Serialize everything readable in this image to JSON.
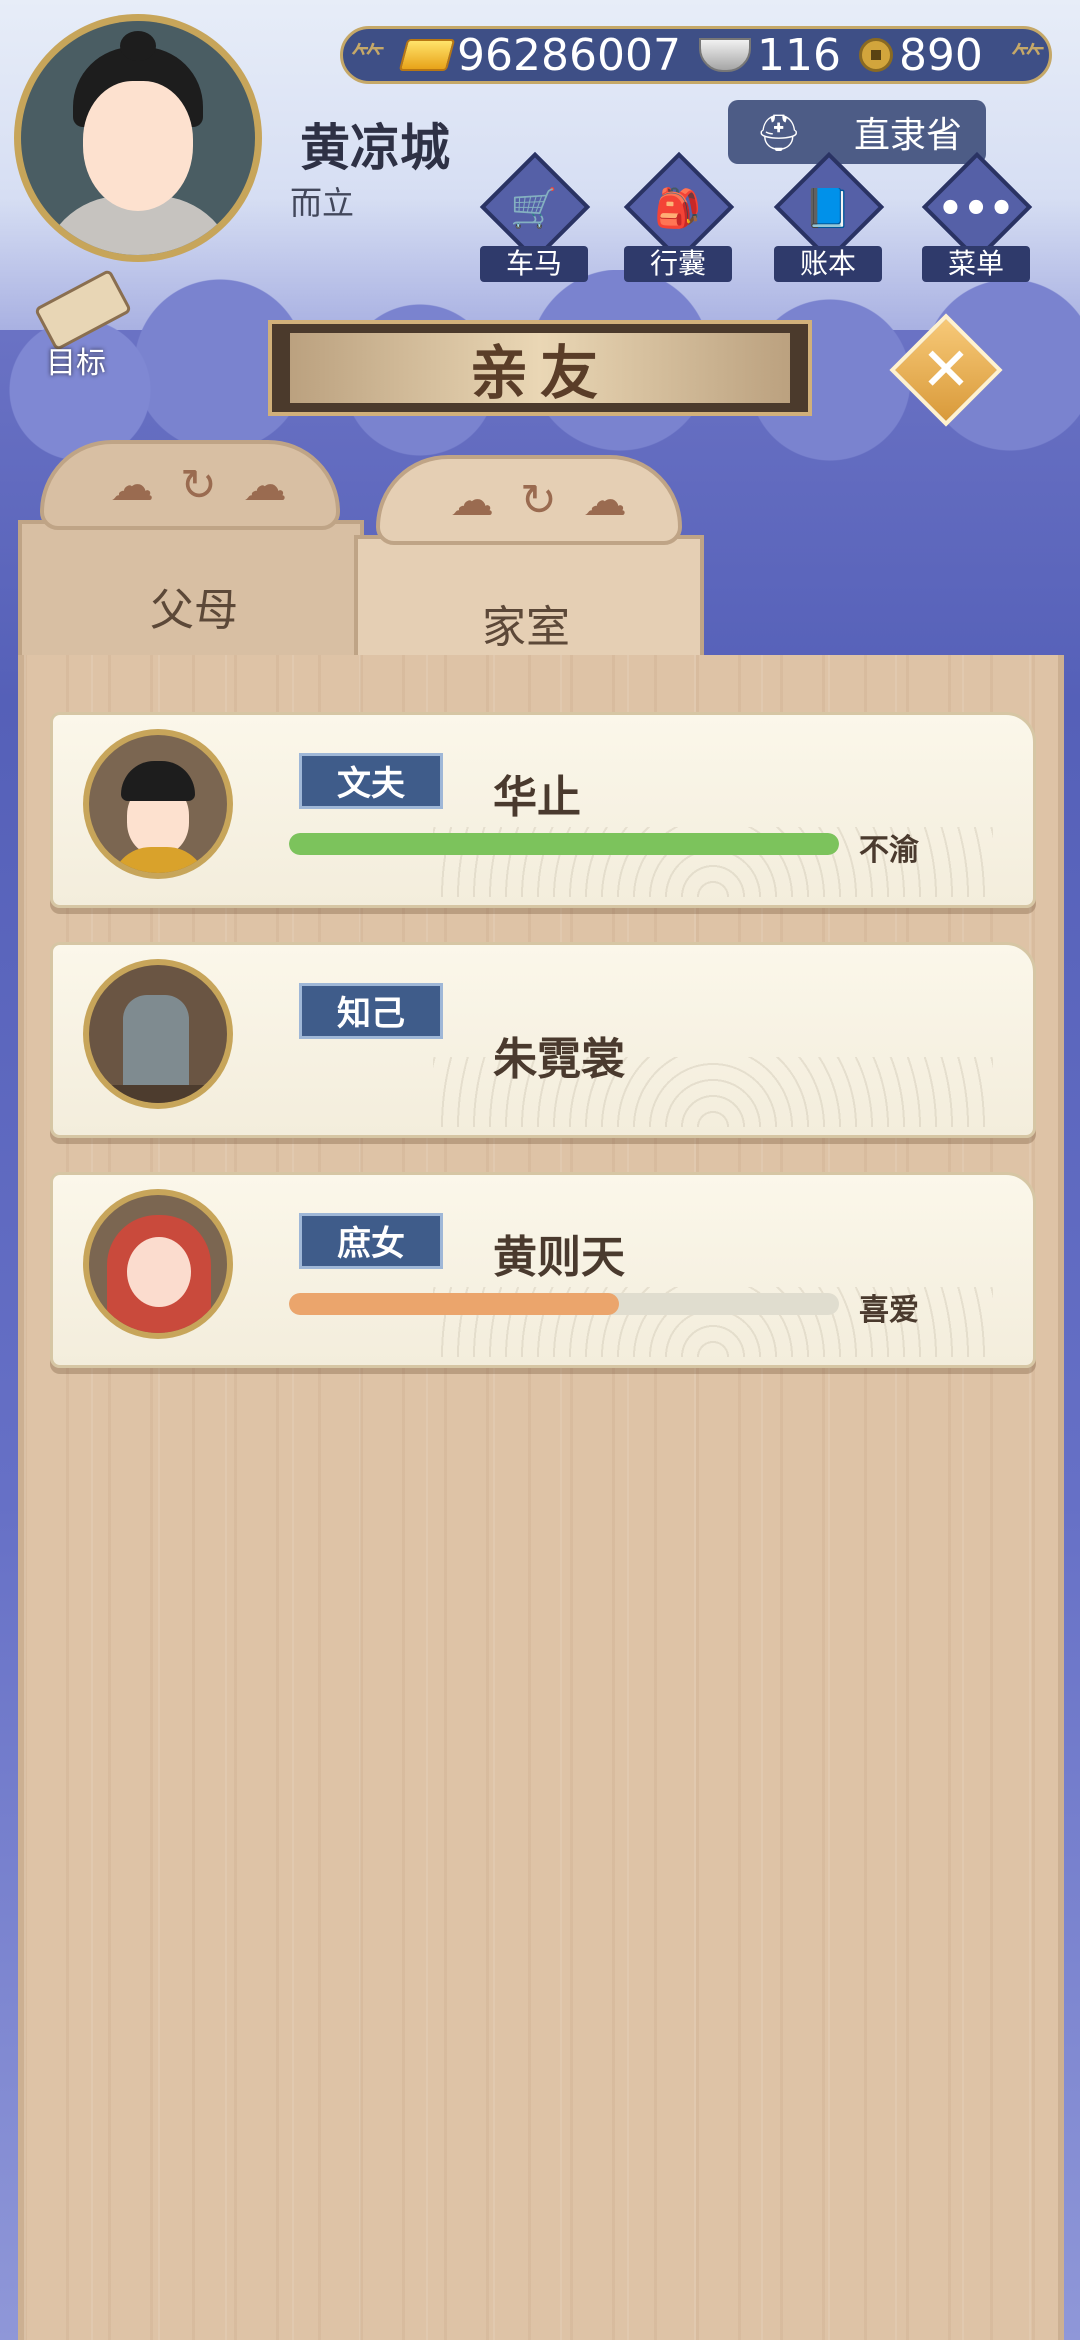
{
  "header": {
    "currencies": [
      {
        "icon": "gold-ingot-icon",
        "value": "96286007"
      },
      {
        "icon": "silver-ingot-icon",
        "value": "116"
      },
      {
        "icon": "copper-coin-icon",
        "value": "890"
      }
    ],
    "player": {
      "name": "黄凉城",
      "title": "而立"
    },
    "province": "直隶省",
    "nav": [
      {
        "key": "carriage",
        "label": "车马",
        "icon": "carriage-icon"
      },
      {
        "key": "bag",
        "label": "行囊",
        "icon": "bag-icon"
      },
      {
        "key": "ledger",
        "label": "账本",
        "icon": "ledger-icon"
      },
      {
        "key": "menu",
        "label": "菜单",
        "icon": "menu-icon"
      }
    ],
    "goal_label": "目标"
  },
  "dialog": {
    "title": "亲友",
    "tabs": [
      {
        "label": "父母",
        "active": false
      },
      {
        "label": "家室",
        "active": true
      }
    ],
    "members": [
      {
        "relation": "文夫",
        "name": "华止",
        "status": "不渝",
        "affection": 1.0,
        "bar_color": "#7cc35c"
      },
      {
        "relation": "知己",
        "name": "朱霓裳"
      },
      {
        "relation": "庶女",
        "name": "黄则天",
        "status": "喜爱",
        "affection": 0.6,
        "bar_color": "#eba56c"
      }
    ]
  },
  "colors": {
    "accent_gold": "#c7a55a",
    "badge_blue": "#3f5c8a",
    "panel_wood": "#dec3a6"
  }
}
